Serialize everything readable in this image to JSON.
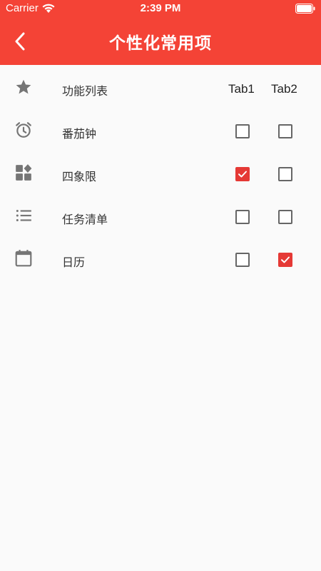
{
  "status_bar": {
    "carrier": "Carrier",
    "time": "2:39 PM",
    "wifi_icon": "wifi-icon",
    "battery_icon": "battery-icon"
  },
  "app_bar": {
    "title": "个性化常用项",
    "back_icon": "chevron-left-icon",
    "color": "#f44336"
  },
  "header_row": {
    "label": "功能列表",
    "icon": "star-icon",
    "tab1": "Tab1",
    "tab2": "Tab2"
  },
  "rows": [
    {
      "label": "番茄钟",
      "icon": "alarm-clock-icon",
      "tab1": false,
      "tab2": false
    },
    {
      "label": "四象限",
      "icon": "widgets-icon",
      "tab1": true,
      "tab2": false
    },
    {
      "label": "任务清单",
      "icon": "list-icon",
      "tab1": false,
      "tab2": false
    },
    {
      "label": "日历",
      "icon": "calendar-icon",
      "tab1": false,
      "tab2": true
    }
  ],
  "colors": {
    "accent": "#e53935",
    "icon_gray": "#757575",
    "background": "#fafafa"
  }
}
